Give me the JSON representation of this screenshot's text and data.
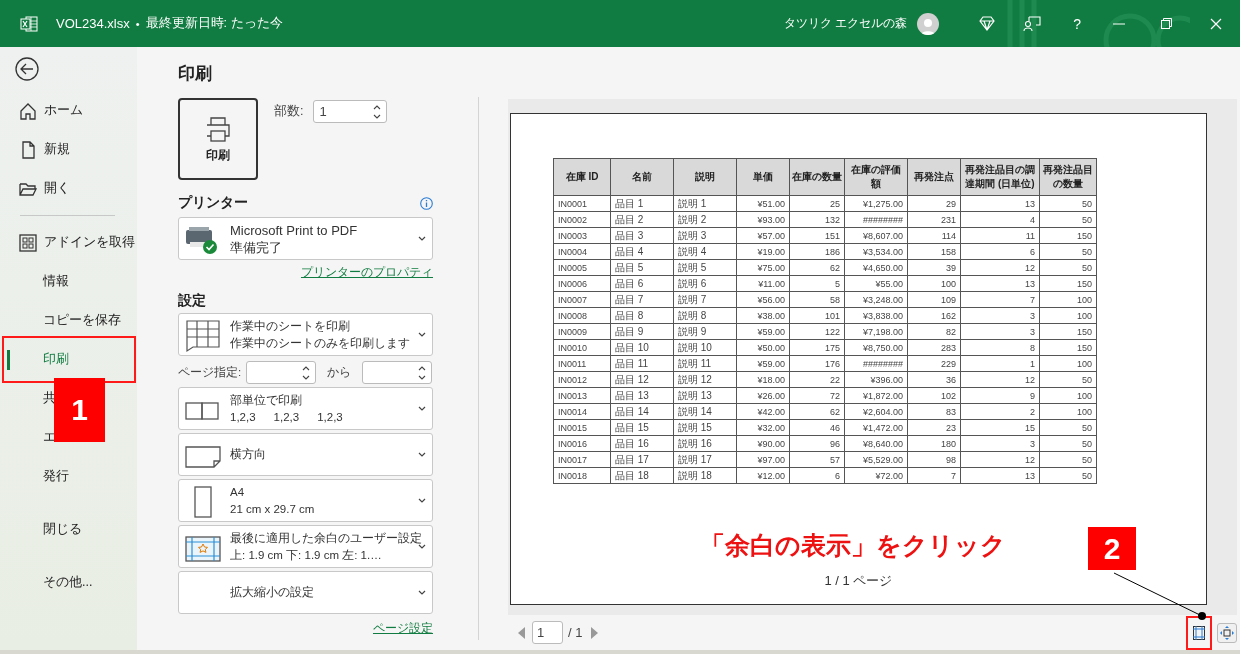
{
  "window": {
    "filename": "VOL234.xlsx",
    "separator": "•",
    "saved_status": "最終更新日時: たった今",
    "user": "タツリク エクセルの森",
    "help": "?"
  },
  "sidebar": {
    "top_items": [
      {
        "label": "ホーム",
        "selected": false
      },
      {
        "label": "新規",
        "selected": false
      },
      {
        "label": "開く",
        "selected": false
      },
      {
        "label": "アドインを取得",
        "selected": false
      }
    ],
    "items": [
      {
        "label": "情報",
        "selected": false,
        "highlighted": false
      },
      {
        "label": "コピーを保存",
        "selected": false,
        "highlighted": false
      },
      {
        "label": "印刷",
        "selected": true,
        "highlighted": true
      },
      {
        "label": "共",
        "selected": false,
        "highlighted": false
      },
      {
        "label": "エ",
        "selected": false,
        "highlighted": false
      },
      {
        "label": "発行",
        "selected": false,
        "highlighted": false
      },
      {
        "label": "閉じる",
        "selected": false,
        "highlighted": false
      },
      {
        "label": "その他...",
        "selected": false,
        "highlighted": false
      }
    ]
  },
  "print": {
    "title": "印刷",
    "print_button": "印刷",
    "copies_label": "部数:",
    "copies_value": "1",
    "printer_heading": "プリンター",
    "printer": {
      "name": "Microsoft Print to PDF",
      "status": "準備完了"
    },
    "printer_properties_link": "プリンターのプロパティ",
    "settings_heading": "設定",
    "settings": [
      {
        "kind": "sheets",
        "title": "作業中のシートを印刷",
        "subtitle": "作業中のシートのみを印刷します"
      },
      {
        "kind": "page_range",
        "label": "ページ指定:",
        "to_label": "から"
      },
      {
        "kind": "collate",
        "title": "部単位で印刷",
        "sequences": [
          "1,2,3",
          "1,2,3",
          "1,2,3"
        ]
      },
      {
        "kind": "orientation",
        "title": "横方向"
      },
      {
        "kind": "paper",
        "title": "A4",
        "subtitle": "21 cm x 29.7 cm"
      },
      {
        "kind": "margins",
        "title": "最後に適用した余白のユーザー設定",
        "subtitle": "上: 1.9 cm 下: 1.9 cm 左: 1.…"
      },
      {
        "kind": "scaling",
        "title": "拡大縮小の設定"
      }
    ],
    "page_setup_link": "ページ設定"
  },
  "preview": {
    "table": {
      "columns": [
        "在庫 ID",
        "名前",
        "説明",
        "単価",
        "在庫の数量",
        "在庫の評価額",
        "再発注点",
        "再発注品目の調達期間 (日単位)",
        "再発注品目の数量"
      ],
      "rows": [
        [
          "IN0001",
          "品目 1",
          "説明 1",
          "¥51.00",
          "25",
          "¥1,275.00",
          "29",
          "13",
          "50"
        ],
        [
          "IN0002",
          "品目 2",
          "説明 2",
          "¥93.00",
          "132",
          "########",
          "231",
          "4",
          "50"
        ],
        [
          "IN0003",
          "品目 3",
          "説明 3",
          "¥57.00",
          "151",
          "¥8,607.00",
          "114",
          "11",
          "150"
        ],
        [
          "IN0004",
          "品目 4",
          "説明 4",
          "¥19.00",
          "186",
          "¥3,534.00",
          "158",
          "6",
          "50"
        ],
        [
          "IN0005",
          "品目 5",
          "説明 5",
          "¥75.00",
          "62",
          "¥4,650.00",
          "39",
          "12",
          "50"
        ],
        [
          "IN0006",
          "品目 6",
          "説明 6",
          "¥11.00",
          "5",
          "¥55.00",
          "100",
          "13",
          "150"
        ],
        [
          "IN0007",
          "品目 7",
          "説明 7",
          "¥56.00",
          "58",
          "¥3,248.00",
          "109",
          "7",
          "100"
        ],
        [
          "IN0008",
          "品目 8",
          "説明 8",
          "¥38.00",
          "101",
          "¥3,838.00",
          "162",
          "3",
          "100"
        ],
        [
          "IN0009",
          "品目 9",
          "説明 9",
          "¥59.00",
          "122",
          "¥7,198.00",
          "82",
          "3",
          "150"
        ],
        [
          "IN0010",
          "品目 10",
          "説明 10",
          "¥50.00",
          "175",
          "¥8,750.00",
          "283",
          "8",
          "150"
        ],
        [
          "IN0011",
          "品目 11",
          "説明 11",
          "¥59.00",
          "176",
          "########",
          "229",
          "1",
          "100"
        ],
        [
          "IN0012",
          "品目 12",
          "説明 12",
          "¥18.00",
          "22",
          "¥396.00",
          "36",
          "12",
          "50"
        ],
        [
          "IN0013",
          "品目 13",
          "説明 13",
          "¥26.00",
          "72",
          "¥1,872.00",
          "102",
          "9",
          "100"
        ],
        [
          "IN0014",
          "品目 14",
          "説明 14",
          "¥42.00",
          "62",
          "¥2,604.00",
          "83",
          "2",
          "100"
        ],
        [
          "IN0015",
          "品目 15",
          "説明 15",
          "¥32.00",
          "46",
          "¥1,472.00",
          "23",
          "15",
          "50"
        ],
        [
          "IN0016",
          "品目 16",
          "説明 16",
          "¥90.00",
          "96",
          "¥8,640.00",
          "180",
          "3",
          "50"
        ],
        [
          "IN0017",
          "品目 17",
          "説明 17",
          "¥97.00",
          "57",
          "¥5,529.00",
          "98",
          "12",
          "50"
        ],
        [
          "IN0018",
          "品目 18",
          "説明 18",
          "¥12.00",
          "6",
          "¥72.00",
          "7",
          "13",
          "50"
        ]
      ]
    },
    "page_footer": "1 / 1 ページ",
    "nav": {
      "page": "1",
      "total": "/ 1"
    },
    "margins_button": {
      "highlighted": true
    }
  },
  "annotations": {
    "callout": "「余白の表示」をクリック",
    "badges": [
      "1",
      "2"
    ]
  }
}
